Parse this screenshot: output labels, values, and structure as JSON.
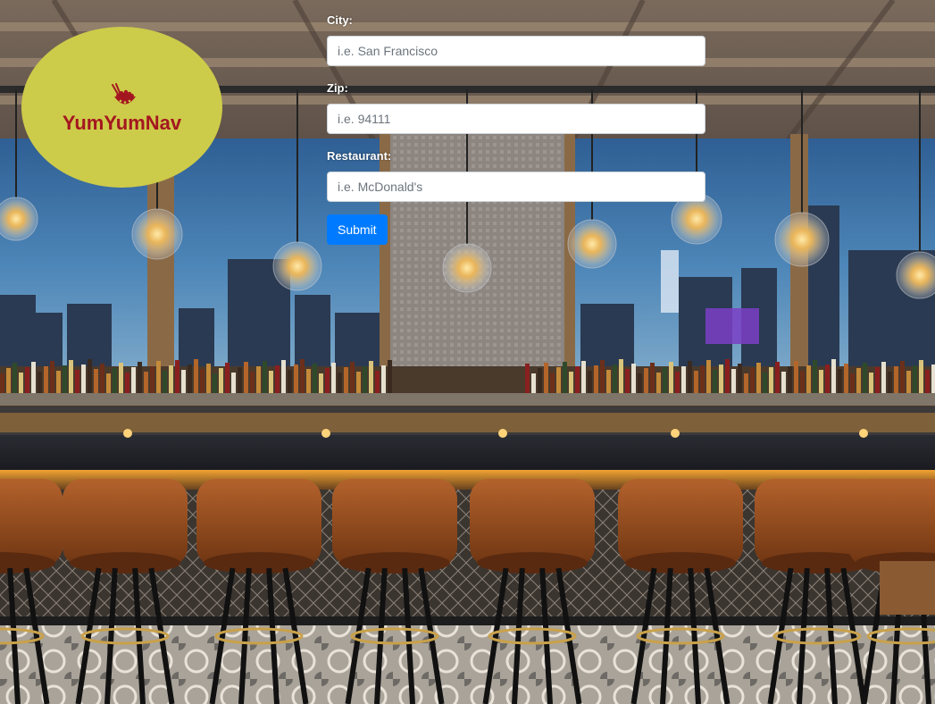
{
  "logo": {
    "name": "YumYumNav",
    "icon": "bowl-with-chopsticks-icon"
  },
  "form": {
    "city": {
      "label": "City:",
      "placeholder": "i.e. San Francisco",
      "value": ""
    },
    "zip": {
      "label": "Zip:",
      "placeholder": "i.e. 94111",
      "value": ""
    },
    "restaurant": {
      "label": "Restaurant:",
      "placeholder": "i.e. McDonald's",
      "value": ""
    },
    "submit_label": "Submit"
  },
  "background": {
    "description_icon": "restaurant-bar-photo"
  },
  "colors": {
    "logo_bg": "#cdcb4a",
    "logo_text": "#a4161f",
    "button": "#007bff"
  }
}
